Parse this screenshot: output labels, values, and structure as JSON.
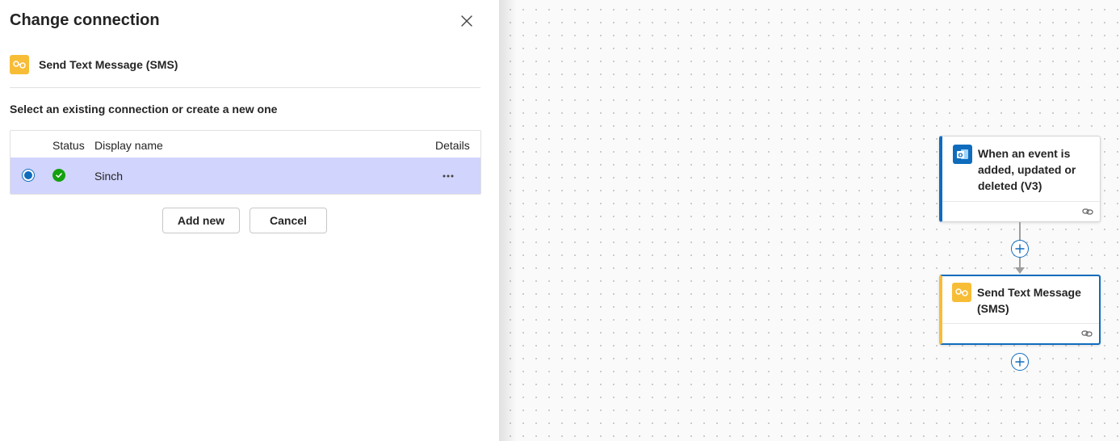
{
  "panel": {
    "title": "Change connection",
    "action_name": "Send Text Message (SMS)",
    "subtitle": "Select an existing connection or create a new one",
    "table": {
      "headers": {
        "status": "Status",
        "display_name": "Display name",
        "details": "Details"
      },
      "rows": [
        {
          "display_name": "Sinch",
          "status": "connected",
          "selected": true,
          "details_icon": "more-horizontal-icon"
        }
      ]
    },
    "buttons": {
      "add_new": "Add new",
      "cancel": "Cancel"
    }
  },
  "canvas": {
    "trigger_card": {
      "title": "When an event is added, updated or deleted (V3)",
      "icon": "outlook-calendar-icon"
    },
    "action_card": {
      "title": "Send Text Message (SMS)",
      "icon": "sms-connector-icon",
      "selected": true
    }
  },
  "colors": {
    "accent": "#0f6cbd",
    "sms_brand": "#f7bd36",
    "selected_row": "#d1d4fc",
    "status_ok": "#13a10e"
  }
}
